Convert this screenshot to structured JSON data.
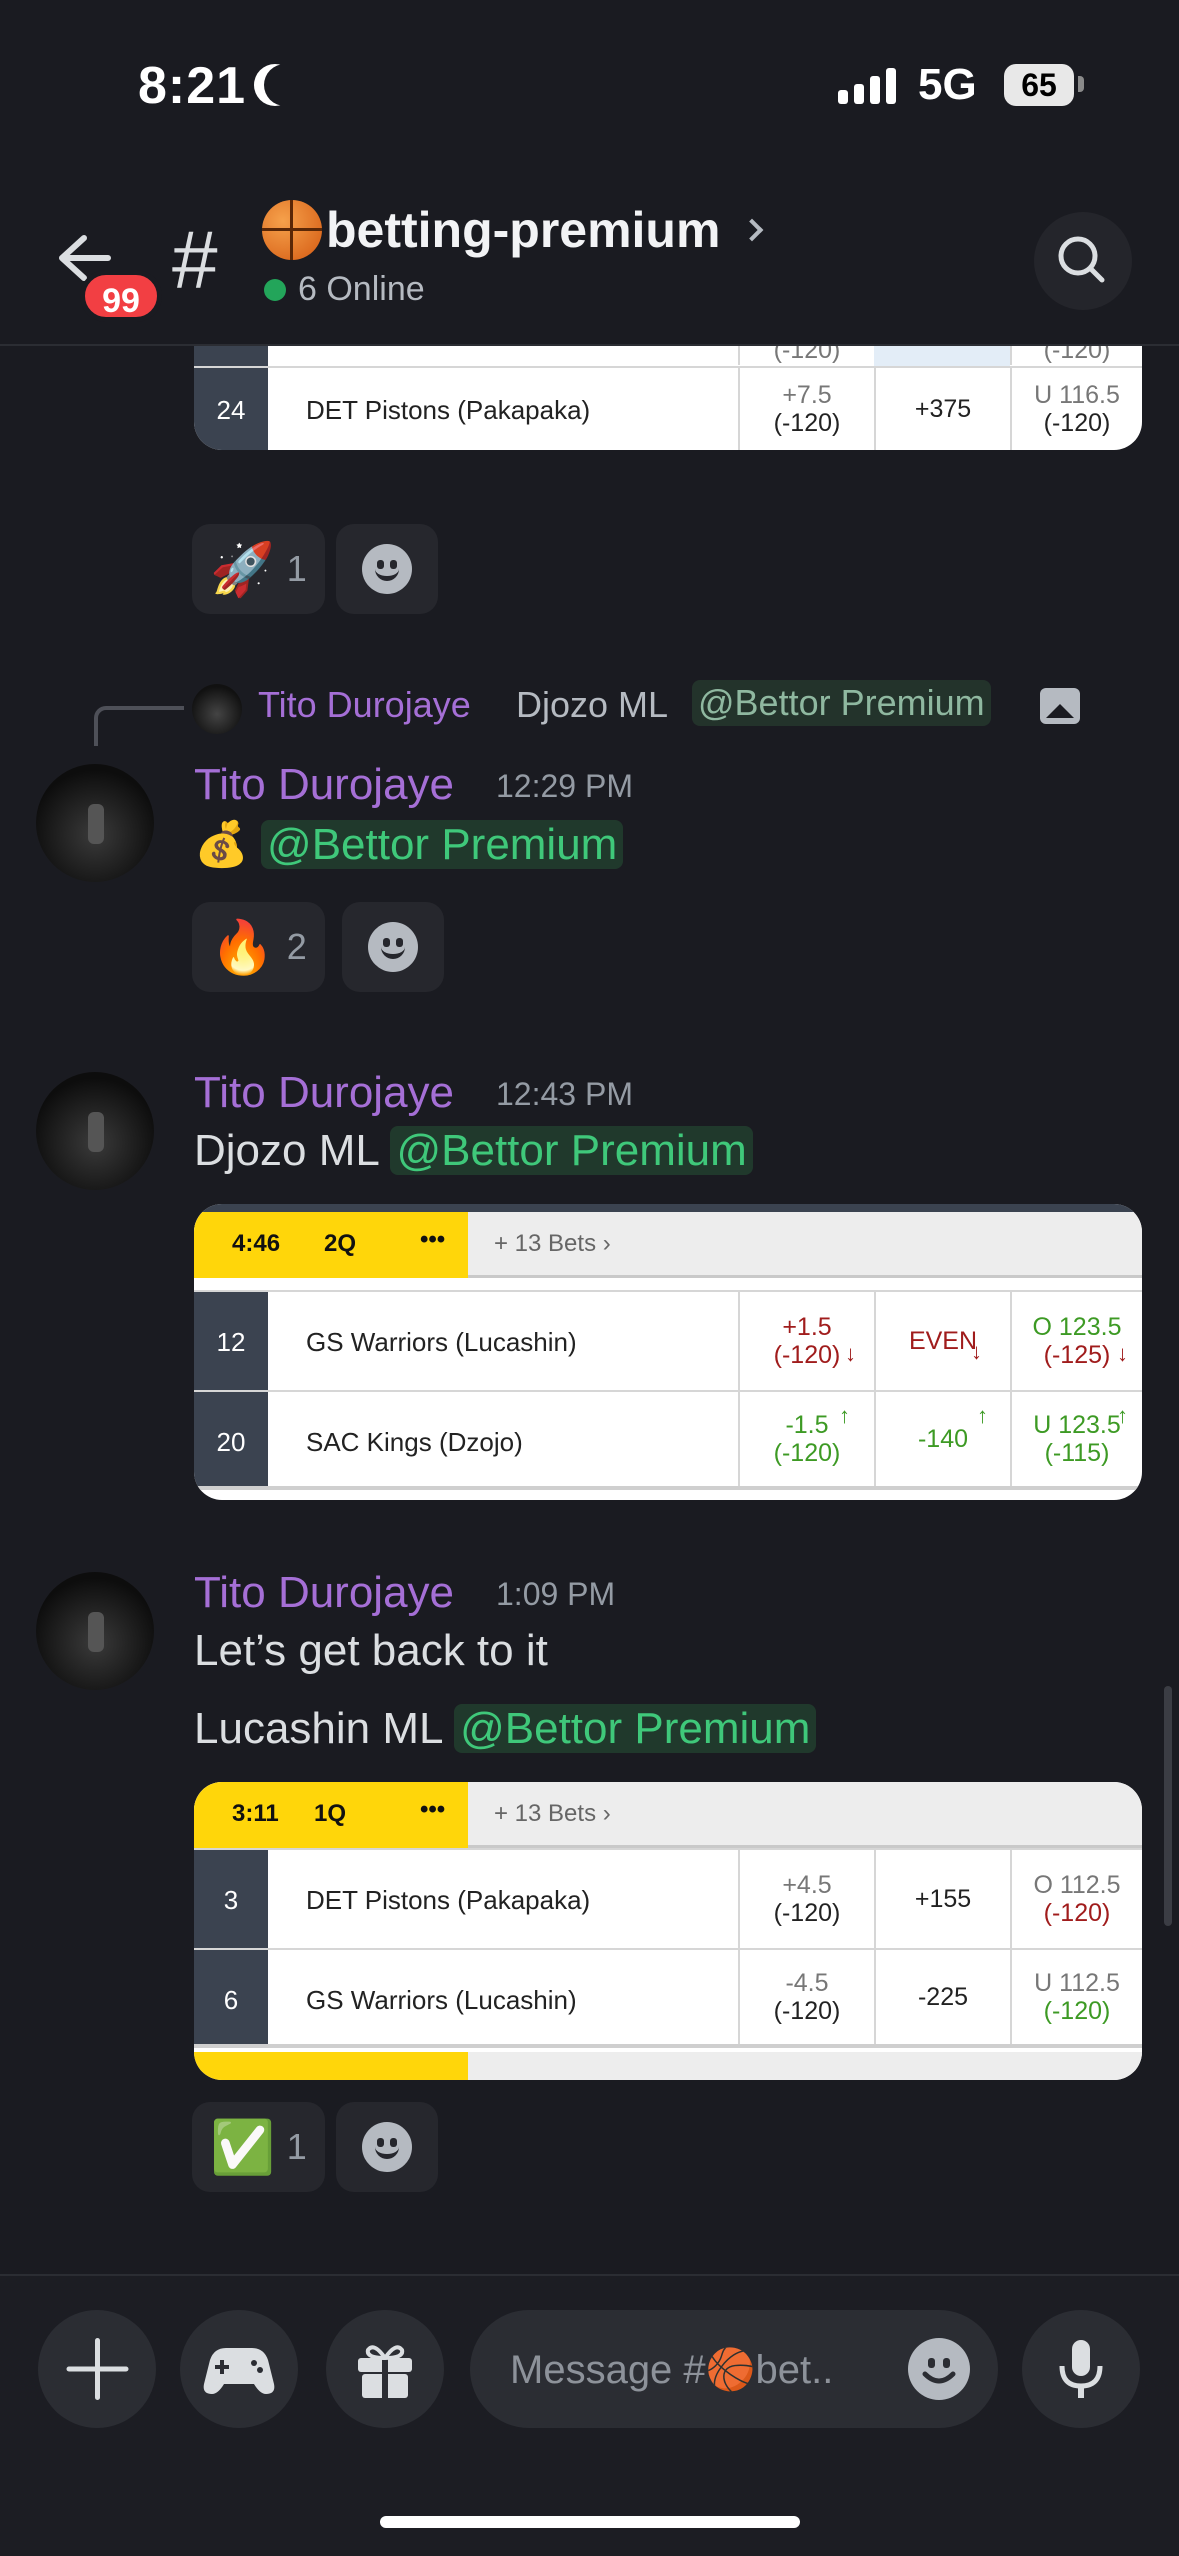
{
  "status": {
    "time": "8:21",
    "network": "5G",
    "battery": "65"
  },
  "header": {
    "badge": "99",
    "hash": "#",
    "channel": "betting-premium",
    "online": "6 Online"
  },
  "mentions": {
    "bettor": "@Bettor Premium"
  },
  "card1": {
    "partial_top": [
      "(-120)",
      "(-120)"
    ],
    "rows": [
      {
        "num": "24",
        "team": "DET Pistons (Pakapaka)",
        "spread": "+7.5",
        "spread_odds": "(-120)",
        "ml": "+375",
        "total": "U 116.5",
        "total_odds": "(-120)"
      }
    ]
  },
  "reactions1": [
    {
      "emoji": "🚀",
      "count": "1"
    }
  ],
  "reply": {
    "name": "Tito Durojaye",
    "text": "Djozo ML"
  },
  "messages": [
    {
      "name": "Tito Durojaye",
      "time": "12:29 PM",
      "text": "💰"
    },
    {
      "name": "Tito Durojaye",
      "time": "12:43 PM",
      "text": "Djozo ML"
    },
    {
      "name": "Tito Durojaye",
      "time": "1:09 PM",
      "line1": "Let’s get back to it",
      "line2": "Lucashin ML"
    }
  ],
  "reactions2": [
    {
      "emoji": "🔥",
      "count": "2"
    }
  ],
  "card2": {
    "clock": "4:46",
    "period": "2Q",
    "dots": "•••",
    "more": "+ 13 Bets",
    "rows": [
      {
        "num": "12",
        "team": "GS Warriors (Lucashin)",
        "spread": "+1.5",
        "spread_odds": "(-120)",
        "ml": "EVEN",
        "total": "O 123.5",
        "total_odds": "(-125)"
      },
      {
        "num": "20",
        "team": "SAC Kings (Dzojo)",
        "spread": "-1.5",
        "spread_odds": "(-120)",
        "ml": "-140",
        "total": "U 123.5",
        "total_odds": "(-115)"
      }
    ]
  },
  "card3": {
    "clock": "3:11",
    "period": "1Q",
    "dots": "•••",
    "more": "+ 13 Bets",
    "rows": [
      {
        "num": "3",
        "team": "DET Pistons (Pakapaka)",
        "spread": "+4.5",
        "spread_odds": "(-120)",
        "ml": "+155",
        "total": "O 112.5",
        "total_odds": "(-120)"
      },
      {
        "num": "6",
        "team": "GS Warriors (Lucashin)",
        "spread": "-4.5",
        "spread_odds": "(-120)",
        "ml": "-225",
        "total": "U 112.5",
        "total_odds": "(-120)"
      }
    ]
  },
  "reactions3": [
    {
      "emoji": "✅",
      "count": "1"
    }
  ],
  "composer": {
    "placeholder": "Message #🏀bet.."
  },
  "colors": {
    "accent_green": "#23a55a",
    "username": "#a56fd6",
    "badge_red": "#f23f43",
    "live_yellow": "#ffd60a"
  }
}
